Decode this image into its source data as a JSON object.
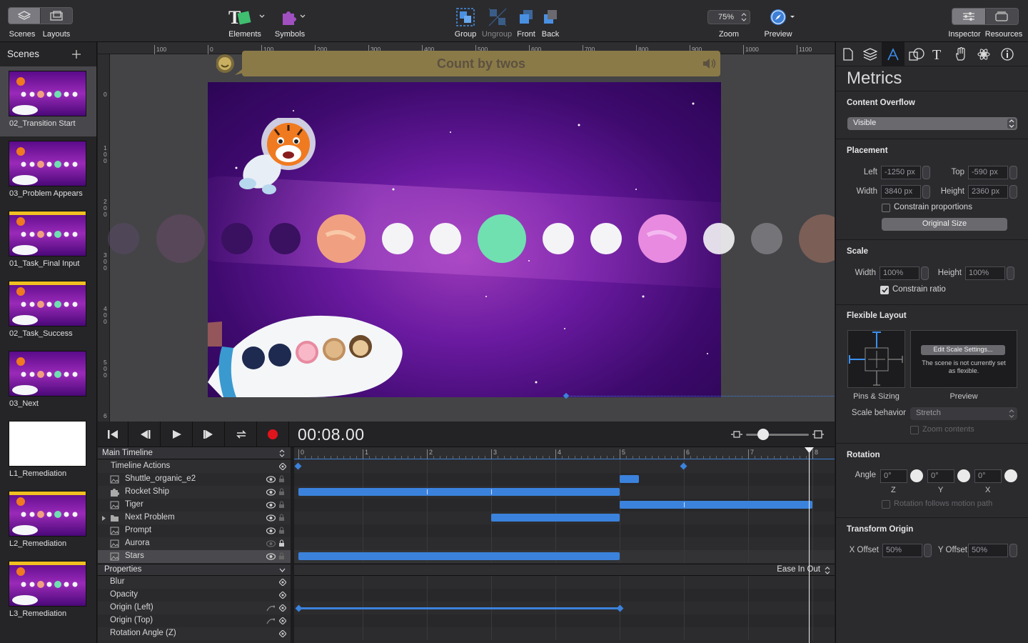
{
  "toolbar": {
    "scenes_label": "Scenes",
    "layouts_label": "Layouts",
    "elements_label": "Elements",
    "symbols_label": "Symbols",
    "group_label": "Group",
    "ungroup_label": "Ungroup",
    "front_label": "Front",
    "back_label": "Back",
    "zoom_value": "75%",
    "zoom_label": "Zoom",
    "preview_label": "Preview",
    "inspector_label": "Inspector",
    "resources_label": "Resources"
  },
  "scenes_panel": {
    "title": "Scenes",
    "add_icon": "plus-icon",
    "items": [
      {
        "name": "02_Transition Start",
        "thumb": "space",
        "selected": true
      },
      {
        "name": "03_Problem Appears",
        "thumb": "space"
      },
      {
        "name": "01_Task_Final Input",
        "thumb": "task"
      },
      {
        "name": "02_Task_Success",
        "thumb": "task"
      },
      {
        "name": "03_Next",
        "thumb": "space"
      },
      {
        "name": "L1_Remediation",
        "thumb": "blank"
      },
      {
        "name": "L2_Remediation",
        "thumb": "task"
      },
      {
        "name": "L3_Remediation",
        "thumb": "task"
      }
    ]
  },
  "ruler": {
    "h_ticks": [
      "100",
      "0",
      "100",
      "200",
      "300",
      "400",
      "500",
      "600",
      "700",
      "800",
      "900",
      "1000",
      "1100"
    ],
    "v_ticks": [
      "0",
      "100",
      "200",
      "300",
      "400",
      "500",
      "6"
    ]
  },
  "stage": {
    "prompt_text": "Count by twos"
  },
  "transport": {
    "time": "00:08.00"
  },
  "timeline": {
    "main_label": "Main Timeline",
    "ticks": [
      "0",
      "1",
      "2",
      "3",
      "4",
      "5",
      "6",
      "7",
      "8"
    ],
    "rows": [
      {
        "name": "Timeline Actions"
      },
      {
        "name": "Shuttle_organic_e2"
      },
      {
        "name": "Rocket Ship"
      },
      {
        "name": "Tiger"
      },
      {
        "name": "Next Problem"
      },
      {
        "name": "Prompt"
      },
      {
        "name": "Aurora"
      },
      {
        "name": "Stars"
      }
    ],
    "properties_label": "Properties",
    "easing": "Ease In Out",
    "properties": [
      {
        "name": "Blur"
      },
      {
        "name": "Opacity"
      },
      {
        "name": "Origin (Left)"
      },
      {
        "name": "Origin (Top)"
      },
      {
        "name": "Rotation Angle (Z)"
      }
    ]
  },
  "inspector": {
    "title": "Metrics",
    "content_overflow_title": "Content Overflow",
    "content_overflow_value": "Visible",
    "placement_title": "Placement",
    "left_label": "Left",
    "left_value": "-1250 px",
    "top_label": "Top",
    "top_value": "-590 px",
    "width_label": "Width",
    "width_value": "3840 px",
    "height_label": "Height",
    "height_value": "2360 px",
    "constrain_proportions": "Constrain proportions",
    "original_size": "Original Size",
    "scale_title": "Scale",
    "scale_width_label": "Width",
    "scale_width_value": "100%",
    "scale_height_label": "Height",
    "scale_height_value": "100%",
    "constrain_ratio": "Constrain ratio",
    "flexible_title": "Flexible Layout",
    "edit_scale": "Edit Scale Settings...",
    "not_flexible": "The scene is not currently set as flexible.",
    "pins_label": "Pins & Sizing",
    "preview_label": "Preview",
    "scale_behavior_label": "Scale behavior",
    "scale_behavior_value": "Stretch",
    "zoom_contents": "Zoom contents",
    "rotation_title": "Rotation",
    "angle_label": "Angle",
    "angle_z": "0°",
    "angle_y": "0°",
    "angle_x": "0°",
    "z_label": "Z",
    "y_label": "Y",
    "x_label": "X",
    "rotation_follows": "Rotation follows motion path",
    "transform_title": "Transform Origin",
    "x_offset_label": "X Offset",
    "x_offset_value": "50%",
    "y_offset_label": "Y Offset",
    "y_offset_value": "50%"
  }
}
